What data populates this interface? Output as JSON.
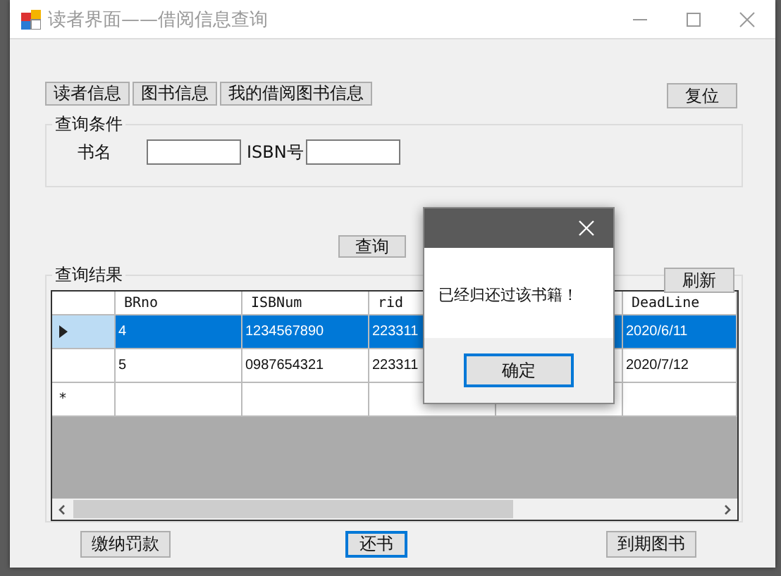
{
  "window": {
    "title": "读者界面——借阅信息查询"
  },
  "nav_buttons": [
    {
      "label": "读者信息"
    },
    {
      "label": "图书信息"
    },
    {
      "label": "我的借阅图书信息"
    }
  ],
  "reset_button": {
    "label": "复位"
  },
  "criteria": {
    "title": "查询条件",
    "fields": [
      {
        "label": "书名"
      },
      {
        "label": "ISBN号"
      }
    ]
  },
  "query_button": {
    "label": "查询"
  },
  "results": {
    "title": "查询结果",
    "refresh_button": {
      "label": "刷新"
    },
    "columns": [
      {
        "label": "BRno"
      },
      {
        "label": "ISBNum"
      },
      {
        "label": "rid"
      },
      {},
      {
        "label": "DeadLine"
      }
    ],
    "rows": [
      {
        "selected": true,
        "cells": [
          "4",
          "1234567890",
          "223311",
          null,
          "2020/6/11"
        ]
      },
      {
        "selected": false,
        "cells": [
          "5",
          "0987654321",
          "223311",
          null,
          "2020/7/12"
        ]
      }
    ],
    "new_row_marker": "*"
  },
  "bottom_buttons": [
    {
      "label": "缴纳罚款",
      "focused": false
    },
    {
      "label": "还书",
      "focused": true
    },
    {
      "label": "到期图书",
      "focused": false
    }
  ],
  "dialog": {
    "message": "已经归还过该书籍！",
    "ok_button": {
      "label": "确定"
    }
  }
}
